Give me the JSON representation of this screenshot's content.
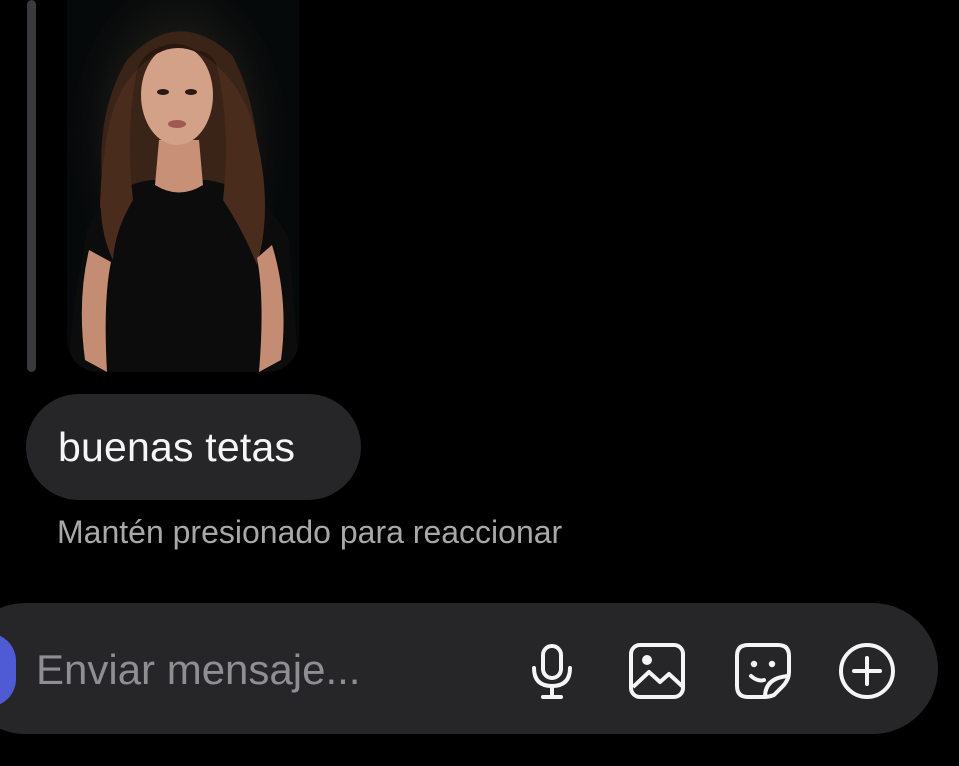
{
  "thread": {
    "shared_media": {
      "type": "photo",
      "icon": "shared-photo"
    },
    "message": {
      "text": "buenas tetas"
    },
    "reaction_hint": "Mantén presionado para reaccionar"
  },
  "composer": {
    "placeholder": "Enviar mensaje...",
    "value": "",
    "buttons": [
      {
        "name": "microphone",
        "icon": "microphone-icon"
      },
      {
        "name": "gallery",
        "icon": "image-icon"
      },
      {
        "name": "sticker",
        "icon": "sticker-icon"
      },
      {
        "name": "more",
        "icon": "plus-circle-icon"
      }
    ]
  },
  "colors": {
    "background": "#000000",
    "bubble": "#262628",
    "hint_text": "#a8a8a8",
    "placeholder": "#8e8e93",
    "accent": "#4f5bd5"
  }
}
